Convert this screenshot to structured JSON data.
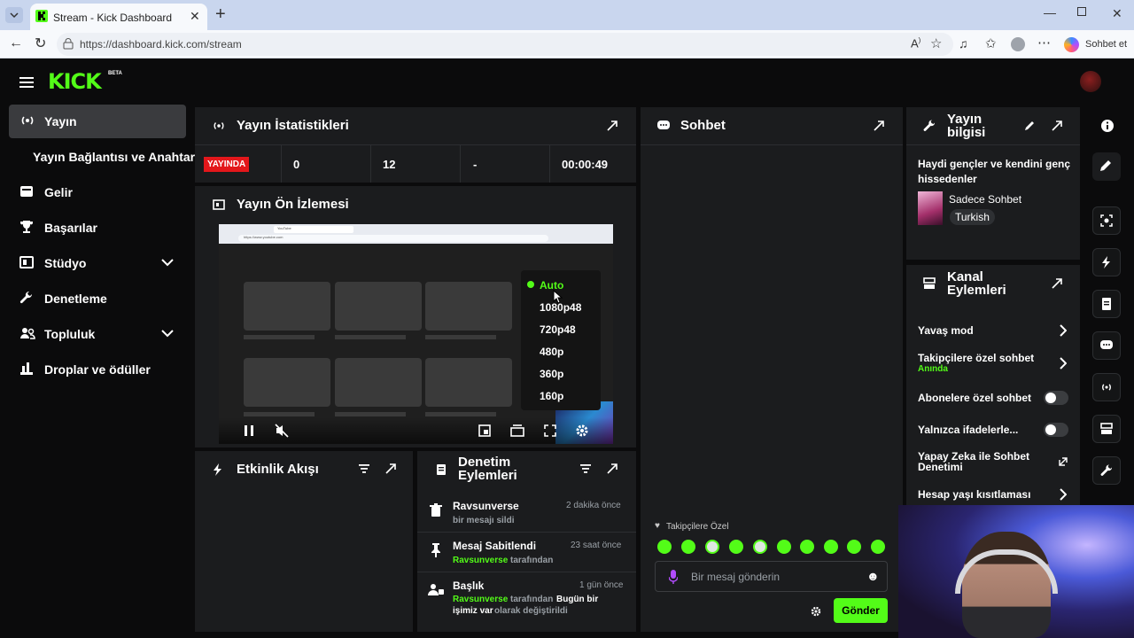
{
  "browser": {
    "tab_title": "Stream - Kick Dashboard",
    "url": "https://dashboard.kick.com/stream",
    "copilot_label": "Sohbet et"
  },
  "header": {
    "logo": "KICK",
    "logo_badge": "BETA"
  },
  "sidebar": {
    "items": [
      {
        "label": "Yayın",
        "icon": "broadcast-icon",
        "active": true
      },
      {
        "label": "Yayın Bağlantısı ve Anahtarı",
        "icon": "",
        "sub": true
      },
      {
        "label": "Gelir",
        "icon": "revenue-icon"
      },
      {
        "label": "Başarılar",
        "icon": "trophy-icon"
      },
      {
        "label": "Stüdyo",
        "icon": "studio-icon",
        "expandable": true
      },
      {
        "label": "Denetleme",
        "icon": "wrench-icon"
      },
      {
        "label": "Topluluk",
        "icon": "community-icon",
        "expandable": true
      },
      {
        "label": "Droplar ve ödüller",
        "icon": "drops-icon"
      }
    ]
  },
  "stats": {
    "title": "Yayın İstatistikleri",
    "live_badge": "YAYINDA",
    "viewers": "0",
    "followers": "12",
    "subs": "-",
    "duration": "00:00:49"
  },
  "preview": {
    "title": "Yayın Ön İzlemesi",
    "quality_menu": {
      "options": [
        "Auto",
        "1080p48",
        "720p48",
        "480p",
        "360p",
        "160p"
      ],
      "selected": "Auto"
    },
    "mini_url": "https://www.youtube.com",
    "mini_tab": "YouTube"
  },
  "activity": {
    "title": "Etkinlik Akışı"
  },
  "moderation": {
    "title": "Denetim Eylemleri",
    "items": [
      {
        "title": "Ravsunverse",
        "time": "2 dakika önce",
        "line": "bir mesajı sildi",
        "icon": "trash-icon"
      },
      {
        "title": "Mesaj Sabitlendi",
        "time": "23 saat önce",
        "user": "Ravsunverse",
        "rest": "tarafından",
        "icon": "pin-icon"
      },
      {
        "title": "Başlık",
        "time": "1 gün önce",
        "user": "Ravsunverse",
        "rest": "tarafından",
        "bold1": "Bugün bir",
        "bold2": "işimiz var",
        "rest2": "olarak değiştirildi",
        "icon": "title-change-icon"
      }
    ]
  },
  "chat": {
    "title": "Sohbet",
    "followers_only": "Takipçilere Özel",
    "placeholder": "Bir mesaj gönderin",
    "send": "Gönder"
  },
  "stream_info": {
    "title_line1": "Yayın",
    "title_line2": "bilgisi",
    "stream_title": "Haydi gençler ve kendini genç hissedenler",
    "category": "Sadece Sohbet",
    "language": "Turkish"
  },
  "channel_actions": {
    "title_line1": "Kanal",
    "title_line2": "Eylemleri",
    "slow_mode": "Yavaş mod",
    "followers_chat": "Takipçilere özel sohbet",
    "followers_chat_sub": "Anında",
    "subs_chat": "Abonelere özel sohbet",
    "emotes_only": "Yalnızca ifadelerle...",
    "ai_mod_1": "Yapay Zeka ile Sohbet",
    "ai_mod_2": "Denetimi",
    "age_restrict": "Hesap yaşı kısıtlaması"
  },
  "colors": {
    "accent": "#53fc18",
    "live": "#e3171b",
    "panel": "#1b1c1e"
  }
}
